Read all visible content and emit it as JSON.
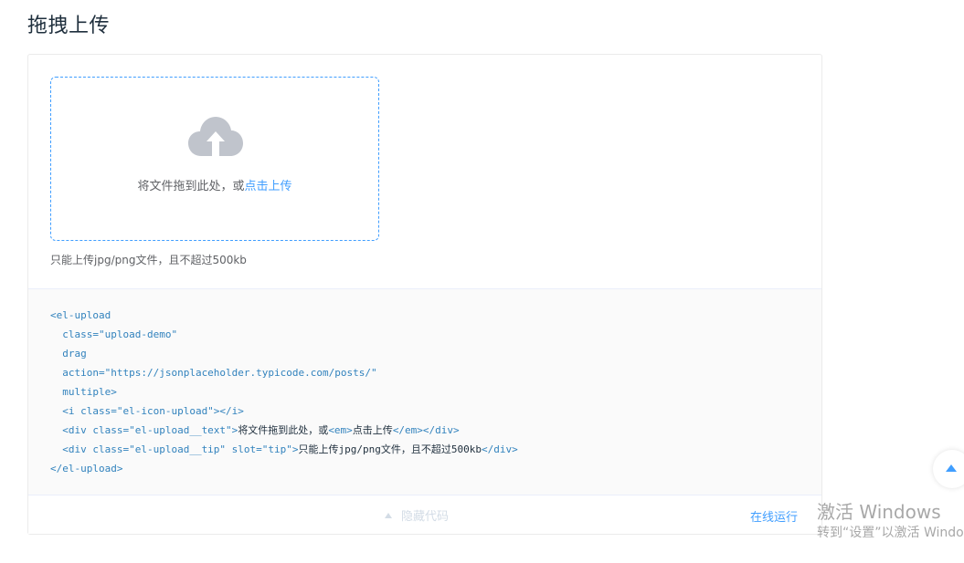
{
  "page": {
    "title": "拖拽上传"
  },
  "upload": {
    "drop_text": "将文件拖到此处，或",
    "click_text": "点击上传",
    "tip": "只能上传jpg/png文件，且不超过500kb",
    "icon": "cloud-upload-icon"
  },
  "code": {
    "lines": [
      "<el-upload",
      "  class=\"upload-demo\"",
      "  drag",
      "  action=\"https://jsonplaceholder.typicode.com/posts/\"",
      "  multiple>",
      "  <i class=\"el-icon-upload\"></i>"
    ],
    "line7": {
      "open": "  <div class=\"el-upload__text\">",
      "text1": "将文件拖到此处，或",
      "em_open": "<em>",
      "text2": "点击上传",
      "close": "</em></div>"
    },
    "line8": {
      "open": "  <div class=\"el-upload__tip\" slot=\"tip\">",
      "text": "只能上传jpg/png文件，且不超过500kb",
      "close": "</div>"
    },
    "last": "</el-upload>"
  },
  "controls": {
    "hide_code": "隐藏代码",
    "run_online": "在线运行"
  },
  "watermark": {
    "title": "激活 Windows",
    "subtitle": "转到“设置”以激活 Windows。"
  },
  "colors": {
    "accent": "#409eff",
    "icon_gray": "#c0c4cc"
  }
}
